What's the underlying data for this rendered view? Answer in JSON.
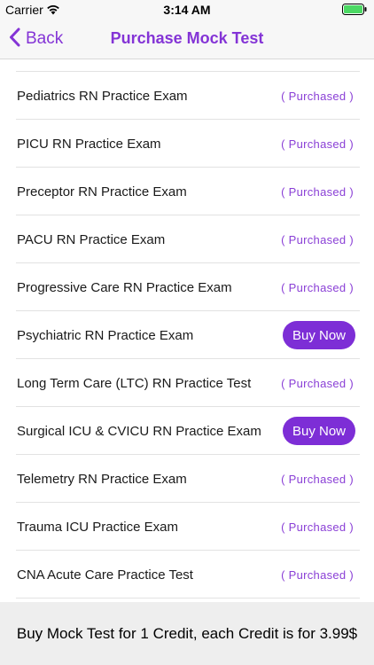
{
  "status_bar": {
    "carrier": "Carrier",
    "time": "3:14 AM"
  },
  "nav": {
    "back_label": "Back",
    "title": "Purchase Mock Test"
  },
  "colors": {
    "accent": "#8434d6",
    "buy_button": "#7d2ed6",
    "purchased_text": "#8a3fd6"
  },
  "items": [
    {
      "title": "Pediatrics RN Practice Exam",
      "status": "( Purchased )"
    },
    {
      "title": "PICU RN Practice Exam",
      "status": "( Purchased )"
    },
    {
      "title": "Preceptor RN Practice Exam",
      "status": "( Purchased )"
    },
    {
      "title": "PACU RN Practice Exam",
      "status": "( Purchased )"
    },
    {
      "title": "Progressive Care RN Practice Exam",
      "status": "( Purchased )"
    },
    {
      "title": "Psychiatric RN Practice Exam",
      "button": "Buy Now"
    },
    {
      "title": "Long Term Care (LTC) RN Practice Test",
      "status": "( Purchased )"
    },
    {
      "title": "Surgical ICU & CVICU RN Practice Exam",
      "button": "Buy Now"
    },
    {
      "title": "Telemetry RN Practice Exam",
      "status": "( Purchased )"
    },
    {
      "title": "Trauma ICU Practice Exam",
      "status": "( Purchased )"
    },
    {
      "title": "CNA Acute Care Practice Test",
      "status": "( Purchased )"
    }
  ],
  "footer": {
    "text": "Buy Mock Test for 1 Credit, each Credit is for 3.99$"
  }
}
